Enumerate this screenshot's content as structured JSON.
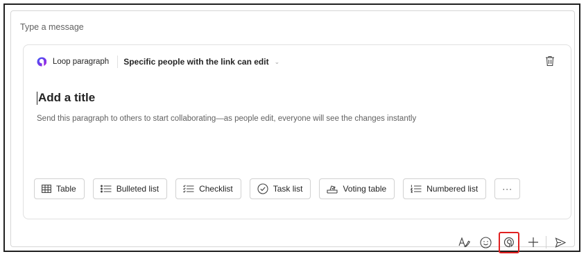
{
  "compose": {
    "placeholder": "Type a message"
  },
  "loop_card": {
    "app_name": "Loop paragraph",
    "permission": "Specific people with the link can edit",
    "title_placeholder": "Add a title",
    "description": "Send this paragraph to others to start collaborating—as people edit, everyone will see the changes instantly",
    "insert_options": [
      {
        "label": "Table",
        "icon": "table-icon"
      },
      {
        "label": "Bulleted list",
        "icon": "bulleted-list-icon"
      },
      {
        "label": "Checklist",
        "icon": "checklist-icon"
      },
      {
        "label": "Task list",
        "icon": "task-list-icon"
      },
      {
        "label": "Voting table",
        "icon": "voting-table-icon"
      },
      {
        "label": "Numbered list",
        "icon": "numbered-list-icon"
      }
    ],
    "more_label": "···"
  },
  "toolbar": {
    "icons": [
      "format-icon",
      "emoji-icon",
      "loop-component-icon",
      "plus-icon",
      "send-icon"
    ],
    "highlight_color": "#e02020"
  },
  "colors": {
    "loop_logo_start": "#6b3df5",
    "loop_logo_end": "#c02ae0",
    "text_primary": "#242424",
    "text_secondary": "#616161"
  }
}
